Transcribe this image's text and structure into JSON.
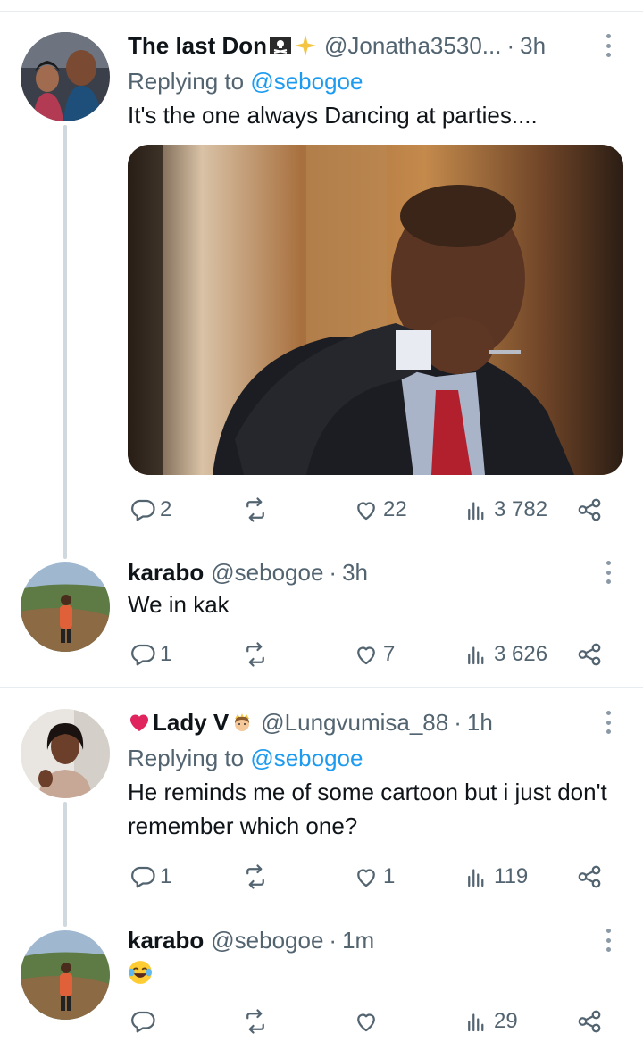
{
  "tweets": [
    {
      "name": "The last Don",
      "name_emoji": [
        "pirate-flag",
        "sparkle"
      ],
      "handle": "@Jonatha3530...",
      "separator": "·",
      "time": "3h",
      "replying_prefix": "Replying to ",
      "replying_to": "@sebogoe",
      "text": "It's the one always Dancing at parties....",
      "replies": "2",
      "retweets": "",
      "likes": "22",
      "views": "3 782"
    },
    {
      "name": "karabo",
      "handle": "@sebogoe",
      "separator": "·",
      "time": "3h",
      "text": "We in kak",
      "replies": "1",
      "retweets": "",
      "likes": "7",
      "views": "3 626"
    },
    {
      "name_prefix_emoji": "red-heart",
      "name": "Lady V",
      "name_emoji": [
        "princess"
      ],
      "handle": "@Lungvumisa_88",
      "separator": "·",
      "time": "1h",
      "replying_prefix": "Replying to ",
      "replying_to": "@sebogoe",
      "text": "He reminds me of some cartoon but i just don't remember which one?",
      "replies": "1",
      "retweets": "",
      "likes": "1",
      "views": "119"
    },
    {
      "name": "karabo",
      "handle": "@sebogoe",
      "separator": "·",
      "time": "1m",
      "text_emoji": "face-with-tears-of-joy",
      "replies": "",
      "retweets": "",
      "likes": "",
      "views": "29"
    }
  ],
  "colors": {
    "link": "#1d9bf0",
    "secondary_text": "#536471",
    "thread_line": "#cfd9de",
    "divider": "#e6ecf0"
  }
}
